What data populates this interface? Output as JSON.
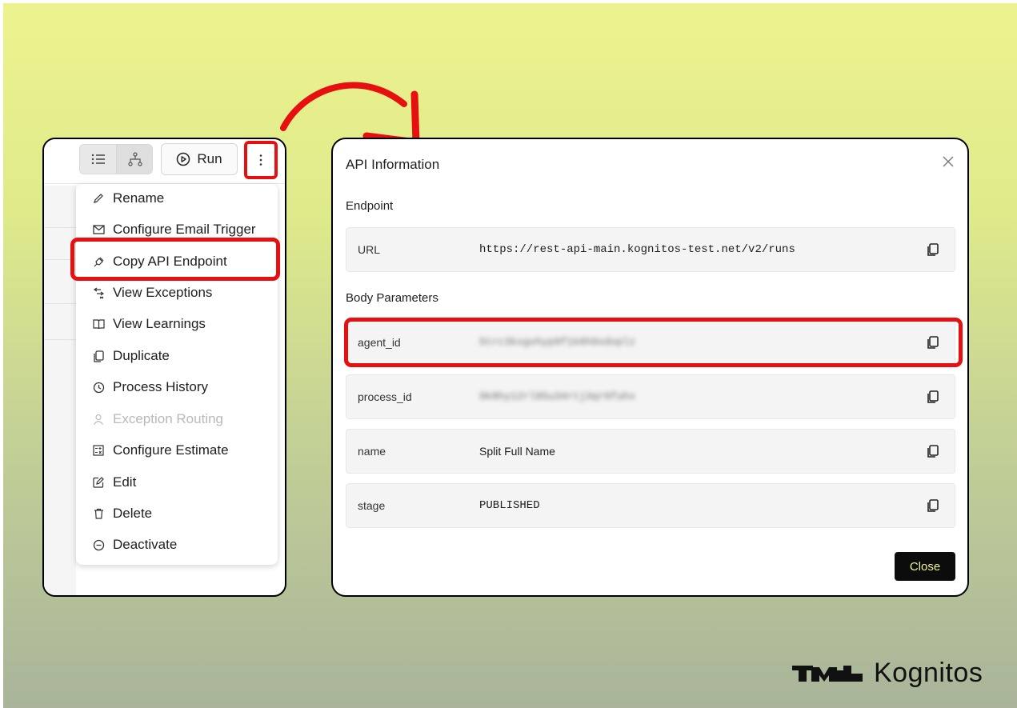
{
  "toolbar": {
    "run_label": "Run"
  },
  "menu": {
    "items": [
      {
        "label": "Rename",
        "icon": "pencil-icon"
      },
      {
        "label": "Configure Email Trigger",
        "icon": "envelope-icon"
      },
      {
        "label": "Copy API Endpoint",
        "icon": "plug-icon"
      },
      {
        "label": "View Exceptions",
        "icon": "exceptions-icon"
      },
      {
        "label": "View Learnings",
        "icon": "book-icon"
      },
      {
        "label": "Duplicate",
        "icon": "copy-icon"
      },
      {
        "label": "Process History",
        "icon": "history-icon"
      },
      {
        "label": "Exception Routing",
        "icon": "user-icon",
        "disabled": true
      },
      {
        "label": "Configure Estimate",
        "icon": "calculator-icon"
      },
      {
        "label": "Edit",
        "icon": "edit-icon"
      },
      {
        "label": "Delete",
        "icon": "trash-icon"
      },
      {
        "label": "Deactivate",
        "icon": "minus-circle-icon"
      }
    ]
  },
  "modal": {
    "title": "API Information",
    "endpoint_label": "Endpoint",
    "url_key": "URL",
    "url_value": "https://rest-api-main.kognitos-test.net/v2/runs",
    "body_label": "Body Parameters",
    "params": [
      {
        "key": "agent_id",
        "value": "5trc3kxgvhyp9f1k6h9xdvplz"
      },
      {
        "key": "process_id",
        "value": "9k8hy12rl85u34rtj3qr9fuhx"
      },
      {
        "key": "name",
        "value": "Split Full Name"
      },
      {
        "key": "stage",
        "value": "PUBLISHED"
      }
    ],
    "close_label": "Close"
  },
  "brand": {
    "name": "Kognitos"
  },
  "colors": {
    "highlight": "#e61010",
    "close_button_bg": "#0c0c0c",
    "close_button_text": "#eef58c"
  }
}
